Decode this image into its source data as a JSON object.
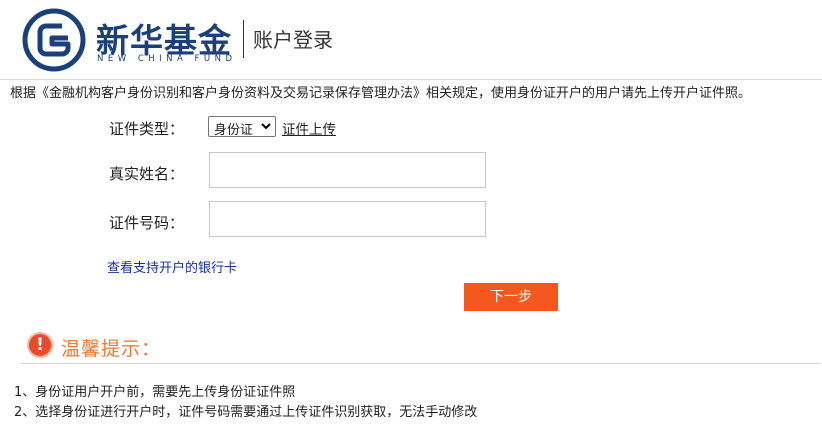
{
  "header": {
    "brand_cn": "新华基金",
    "brand_en": "NEW CHINA FUND",
    "page_title": "账户登录",
    "logo_color": "#1a3f7a"
  },
  "notice": "根据《金融机构客户身份识别和客户身份资料及交易记录保存管理办法》相关规定，使用身份证开户的用户请先上传开户证件照。",
  "form": {
    "id_type_label": "证件类型：",
    "id_type_value": "身份证",
    "upload_link": "证件上传",
    "name_label": "真实姓名：",
    "name_value": "",
    "id_number_label": "证件号码：",
    "id_number_value": ""
  },
  "bank_link": "查看支持开户的银行卡",
  "next_button": "下一步",
  "tips": {
    "icon": "exclamation-icon",
    "title": "温馨提示：",
    "items": [
      "1、身份证用户开户前，需要先上传身份证证件照",
      "2、选择身份证进行开户时，证件号码需要通过上传证件识别获取，无法手动修改"
    ]
  },
  "colors": {
    "button": "#f4581c",
    "tips_title": "#f07a3a",
    "alert_icon": "#e94b2c",
    "link": "#1a2fa0"
  }
}
